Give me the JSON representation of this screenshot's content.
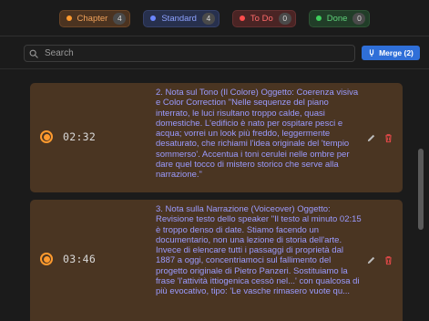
{
  "filters": [
    {
      "label": "Chapter",
      "count": "4",
      "color": "#ff9a2e"
    },
    {
      "label": "Standard",
      "count": "4",
      "color": "#6b86ff"
    },
    {
      "label": "To Do",
      "count": "0",
      "color": "#ff4d4d"
    },
    {
      "label": "Done",
      "count": "0",
      "color": "#3ecf5c"
    }
  ],
  "search": {
    "placeholder": "Search",
    "value": ""
  },
  "merge": {
    "label": "Merge (2)"
  },
  "markers": [
    {
      "time": "02:32",
      "text": "2. Nota sul Tono (Il Colore)  Oggetto: Coerenza visiva e Color Correction \"Nelle sequenze del piano interrato, le luci risultano troppo calde, quasi domestiche. L'edificio è nato per ospitare pesci e acqua; vorrei un look più freddo, leggermente desaturato, che richiami l'idea originale del 'tempio sommerso'. Accentua i toni cerulei nelle ombre per dare quel tocco di mistero storico che serve alla narrazione.\""
    },
    {
      "time": "03:46",
      "text": "3. Nota sulla Narrazione (Voiceover)  Oggetto: Revisione testo dello speaker \"Il testo al minuto 02:15 è troppo denso di date. Stiamo facendo un documentario, non una lezione di storia dell'arte. Invece di elencare tutti i passaggi di proprietà dal 1887 a oggi, concentriamoci sul fallimento del progetto originale di Pietro Panzeri. Sostituiamo la frase 'l'attività ittiogenica cessò nel...' con qualcosa di più evocativo, tipo: 'Le vasche rimasero vuote qu..."
    }
  ]
}
